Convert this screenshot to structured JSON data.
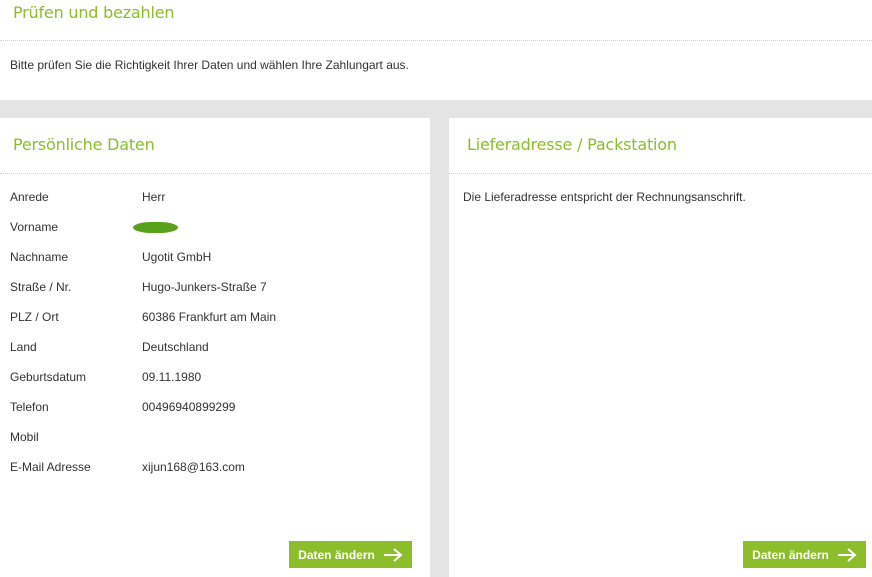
{
  "header": {
    "title": "Prüfen und bezahlen",
    "intro": "Bitte prüfen Sie die Richtigkeit Ihrer Daten und wählen Ihre Zahlungart aus."
  },
  "personal": {
    "title": "Persönliche Daten",
    "rows": [
      {
        "label": "Anrede",
        "value": "Herr"
      },
      {
        "label": "Vorname",
        "value": ""
      },
      {
        "label": "Nachname",
        "value": "Ugotit GmbH"
      },
      {
        "label": "Straße / Nr.",
        "value": "Hugo-Junkers-Straße 7"
      },
      {
        "label": "PLZ / Ort",
        "value": "60386 Frankfurt am Main"
      },
      {
        "label": "Land",
        "value": "Deutschland"
      },
      {
        "label": "Geburtsdatum",
        "value": "09.11.1980"
      },
      {
        "label": "Telefon",
        "value": "00496940899299"
      },
      {
        "label": "Mobil",
        "value": ""
      },
      {
        "label": "E-Mail Adresse",
        "value": "xijun168@163.com"
      }
    ],
    "button_label": "Daten ändern",
    "button_icon": "arrow-right-icon"
  },
  "delivery": {
    "title": "Lieferadresse / Packstation",
    "text": "Die Lieferadresse entspricht der Rechnungsanschrift.",
    "button_label": "Daten ändern",
    "button_icon": "arrow-right-icon"
  },
  "colors": {
    "accent": "#8cbd2a",
    "background_gray": "#e4e4e4",
    "redaction": "#5aa11b"
  }
}
